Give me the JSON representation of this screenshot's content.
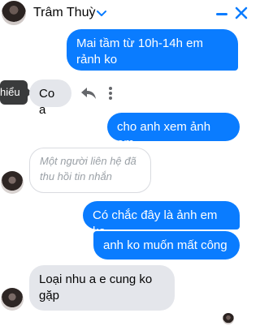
{
  "header": {
    "contact_name": "Trâm Thuỳ",
    "icons": [
      "chevron-down-icon",
      "minimize-icon",
      "close-icon"
    ],
    "accent_color": "#0a7cff"
  },
  "tooltip": {
    "text": "hiểu"
  },
  "messages": [
    {
      "side": "out",
      "text": "Mai tầm từ 10h-14h em rảnh ko"
    },
    {
      "side": "in",
      "text": "Co a"
    },
    {
      "side": "out",
      "text": "cho anh xem ảnh em"
    },
    {
      "side": "in",
      "text": "Một người liên hệ đã thu hồi tin nhắn",
      "recalled": true
    },
    {
      "side": "out",
      "text": "Có chắc đây là ảnh em ko"
    },
    {
      "side": "out",
      "text": "anh ko muốn mất công"
    },
    {
      "side": "in",
      "text": "Loại nhu a e cung ko gặp"
    }
  ],
  "colors": {
    "outgoing_bubble": "#0a7cff",
    "incoming_bubble": "#e4e6eb",
    "tooltip": "#3a3b3c"
  }
}
